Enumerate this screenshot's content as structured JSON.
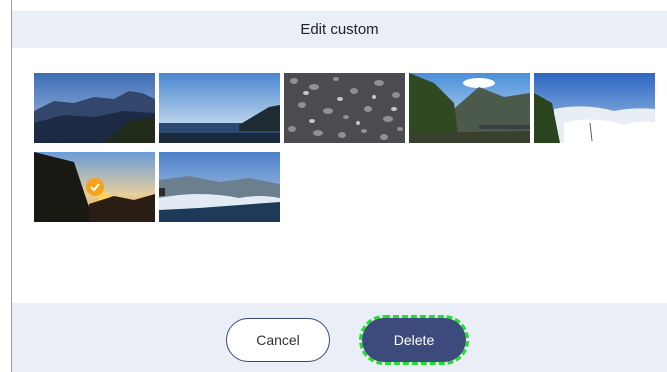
{
  "dialog": {
    "title": "Edit custom"
  },
  "thumbnails": [
    {
      "id": "mountain-dusk",
      "selected": false
    },
    {
      "id": "lake-sunset",
      "selected": false
    },
    {
      "id": "pebbles",
      "selected": false
    },
    {
      "id": "forest-bridge",
      "selected": false
    },
    {
      "id": "cloud-sea",
      "selected": false
    },
    {
      "id": "sunset-trees",
      "selected": true
    },
    {
      "id": "cloud-valley",
      "selected": false
    }
  ],
  "buttons": {
    "cancel_label": "Cancel",
    "delete_label": "Delete"
  },
  "colors": {
    "header_bg": "#eaeff7",
    "delete_bg": "#3d4a7c",
    "check": "#f6a31c",
    "highlight": "#21e02b"
  }
}
